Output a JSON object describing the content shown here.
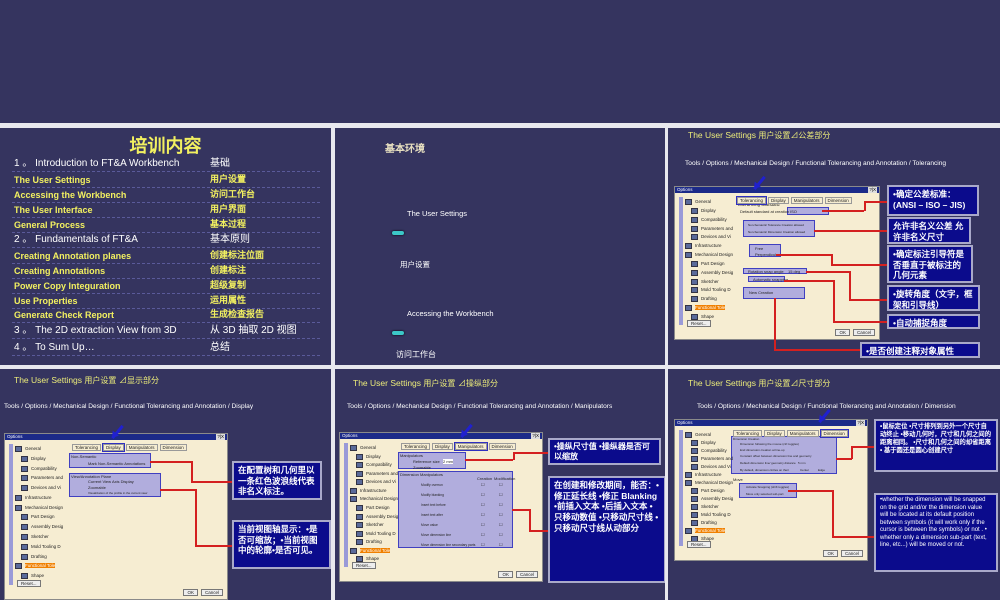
{
  "slides": {
    "toc": {
      "title": "培训内容",
      "rows": [
        {
          "en": "1 。 Introduction to FT&A Workbench",
          "cn": "基础",
          "main": true
        },
        {
          "en": "The User Settings",
          "cn": "用户设置"
        },
        {
          "en": "Accessing the Workbench",
          "cn": "访问工作台"
        },
        {
          "en": "The User Interface",
          "cn": "用户界面"
        },
        {
          "en": "General Process",
          "cn": "基本过程"
        },
        {
          "en": "2 。 Fundamentals of FT&A",
          "cn": "基本原则",
          "main": true
        },
        {
          "en": "Creating Annotation planes",
          "cn": "创建标注位面"
        },
        {
          "en": "Creating Annotations",
          "cn": "创建标注"
        },
        {
          "en": "Power Copy Integuration",
          "cn": "超级复制"
        },
        {
          "en": "Use Properties",
          "cn": "运用属性"
        },
        {
          "en": "Generate Check Report",
          "cn": "生成检查报告"
        },
        {
          "en": "3 。 The 2D extraction View from 3D",
          "cn": "从 3D 抽取 2D 视图",
          "main": true
        },
        {
          "en": "4 。 To Sum Up…",
          "cn": "总结",
          "main": true
        }
      ]
    },
    "env": {
      "title": "基本环境",
      "item1_en": "The User Settings",
      "item1_cn": "用户设置",
      "item2_en": "Accessing the Workbench",
      "item2_cn": "访问工作台"
    },
    "tolerancing": {
      "title_en": "The User Settings",
      "title_cn": "用户设置⊿公差部分",
      "path": "Tools / Options / Mechanical Design / Functional Tolerancing and Annotation / Tolerancing",
      "callouts": [
        "•确定公差标准：(ANSI – ISO – JIS)",
        "允许非名义公差 允许非名义尺寸",
        "•确定标注引导符是否垂直于被标注的几何元素",
        "•旋转角度（文字，框架和引导线）",
        "•自动捕捉角度",
        "•是否创建注释对象属性"
      ],
      "fields": [
        "Tolerancing Standard",
        "Default standard at creation",
        "ISO",
        "Non-Semantic Tolerance Creation allowed",
        "Non-Semantic Dimension Creation allowed",
        "Free",
        "Perpendicular",
        "Rotation snap angle",
        "15 deg",
        "Automatic snapping",
        "New Creation"
      ]
    },
    "display": {
      "title_en": "The User Settings",
      "title_cn": "用户设置 ⊿显示部分",
      "path": "Tools / Options / Mechanical Design / Functional Tolerancing and Annotation / Display",
      "callouts": [
        "在配置树和几何里以一条红色波浪线代表非名义标注。",
        "当前视图轴显示：•是否可缩放；•当前视图中的轮廓•是否可见。"
      ],
      "fields": [
        "Non-Semantic",
        "Mark Non-Semantic Annotations",
        "View/Annotation Plane",
        "Current View Axis Display",
        "Zoomable",
        "Visualization of the profile in the current view"
      ]
    },
    "manipulators": {
      "title_en": "The User Settings",
      "title_cn": "用户设置 ⊿操纵部分",
      "path": "Tools / Options / Mechanical Design / Functional Tolerancing and Annotation / Manipulators",
      "callouts": [
        "•操纵尺寸值 •操纵器是否可以缩放",
        "在创建和修改期间，能否：•修正延长线 •修正 Blanking •前插入文本 •后插入文本 •只移动数值 •只移动尺寸线 •只移动尺寸线从动部分"
      ],
      "fields": [
        "Manipulators",
        "Reference size",
        "2 mm",
        "Zoomable",
        "Dimension Manipulators",
        "Creation",
        "Modification",
        "Modify overrun",
        "Modify blanking",
        "Insert text before",
        "Insert text after",
        "Move value",
        "Move dimension line",
        "Move dimension line secondary parts"
      ]
    },
    "dimension": {
      "title_en": "The User Settings",
      "title_cn": "用户设置⊿尺寸部分",
      "path": "Tools / Options / Mechanical Design / Functional Tolerancing and Annotation / Dimension",
      "callouts": [
        "•鼠标定位 •尺寸排列到另外一个尺寸自动终止 •移动几何时，尺寸和几何之间的距离相同。 •尺寸和几何之间的却省距离 • 基于圆还是圆心创建尺寸",
        "•whether the dimension will be snapped on the grid and/or the dimension value will be located at its default position between symbols (it will work only if the cursor is between the symbols) or not . • whether only a dimension sub-part (text, line, etc...) will be moved or not."
      ],
      "fields": [
        "Dimension Creation",
        "Dimension following the mouse (ctrl toggles)",
        "End dimension creation at line-up",
        "Constant offset between dimension line and geometry",
        "Default dimension line/ geometry distance",
        "5 mm",
        "By default, dimension circles on their",
        "Center",
        "Edge",
        "Move",
        "Activate Snapping (shift toggles)",
        "Move only selected sub-part"
      ]
    }
  },
  "dialog": {
    "title": "Options",
    "close": "?|X",
    "tabs": [
      "Tolerancing",
      "Display",
      "Manipulators",
      "Dimension"
    ],
    "tree": [
      "General",
      "Display",
      "Compatibility",
      "Parameters and",
      "Devices and Vi",
      "Infrastructure",
      "Mechanical Design",
      "Part Design",
      "Assembly Desig",
      "Sketcher",
      "Mold Tooling D",
      "Drafting",
      "Functional Tole",
      "Shape"
    ],
    "reset": "Reset...",
    "ok": "OK",
    "cancel": "Cancel"
  }
}
